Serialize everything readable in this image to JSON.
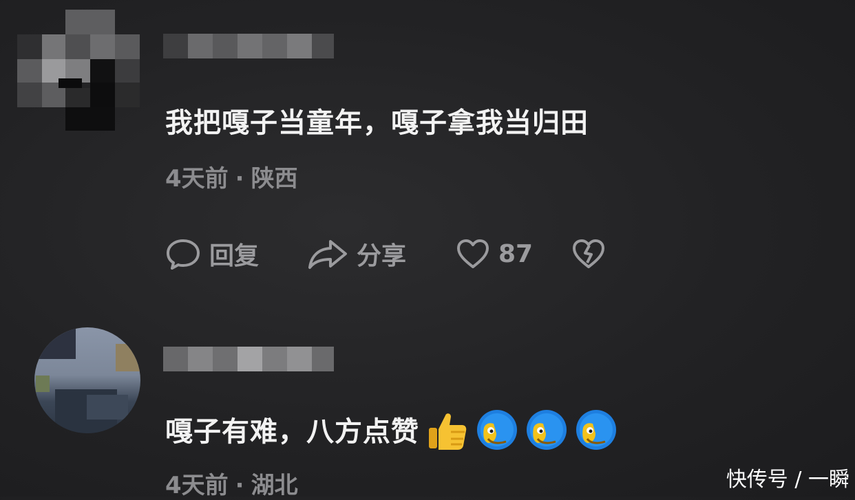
{
  "comments": [
    {
      "username": "",
      "text": "我把嘎子当童年，嘎子拿我当归田",
      "time": "4天前",
      "separator": "·",
      "location": "陕西",
      "actions": {
        "reply_label": "回复",
        "share_label": "分享",
        "like_count": "87"
      }
    },
    {
      "username": "",
      "text": "嘎子有难，八方点赞",
      "emojis": [
        "thumbs-up-icon",
        "doge-emoji-icon",
        "doge-emoji-icon",
        "doge-emoji-icon"
      ],
      "time": "4天前",
      "separator": "·",
      "location": "湖北"
    }
  ],
  "watermark": "快传号 / 一瞬",
  "colors": {
    "background": "#222224",
    "text": "#f2f2f2",
    "meta": "#8c8c8f",
    "icon": "#9b9b9e",
    "emoji_blue": "#1e7fe0",
    "emoji_yellow": "#f3c21b"
  }
}
